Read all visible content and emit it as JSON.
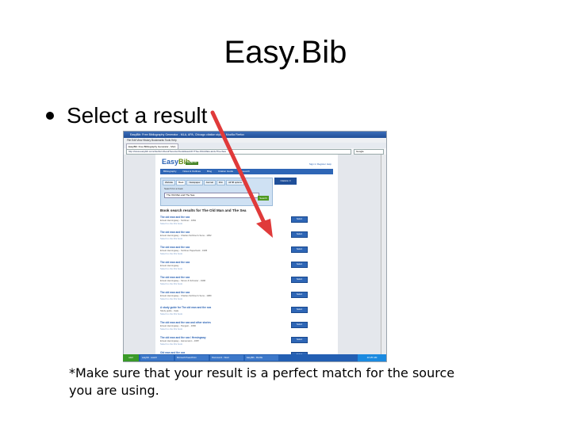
{
  "slide": {
    "title": "Easy.Bib",
    "bullet": "Select a result",
    "note": "*Make sure that your result is a perfect match for the source you are using."
  },
  "browser": {
    "window_title": "EasyBib: Free Bibliography Generator - MLA, APA, Chicago citation styles - Mozilla Firefox",
    "menu": "File  Edit  View  History  Bookmarks  Tools  Help",
    "tab_label": "EasyBib: Free Bibliography Generator - MLA",
    "url": "http://www.easybib.com/cite/form/book?source=book&search=The+Old+Man+and+The+Sea",
    "search_placeholder": "Google"
  },
  "easybib": {
    "logo_main": "Easy",
    "logo_accent": "Bib",
    "promo": "EasyBib Pro",
    "user_links": "Sign in  Register  Help",
    "nav": [
      "Bibliography",
      "Notes & Outlines",
      "Blog",
      "Citation Guide",
      "Research"
    ],
    "source_tabs": [
      "Website",
      "Book",
      "Newspaper",
      "Journal",
      "Film",
      "All 58 options"
    ],
    "search_label": "Search for a book",
    "search_value": "The Old Man and The Sea",
    "search_button": "Search",
    "cite_count": "Citations: 0",
    "results_heading": "Book search results for The Old Man and The Sea",
    "results": [
      {
        "title": "The old man and the sea",
        "meta": "Ernest Hemingway - Scribner - 1952",
        "url": "Select to cite this book"
      },
      {
        "title": "The old man and the sea",
        "meta": "Ernest Hemingway - Charles Scribner's Sons - 1952",
        "url": "Select to cite this book"
      },
      {
        "title": "The old man and the sea",
        "meta": "Ernest Hemingway - Scribner Paperback - 1995",
        "url": "Select to cite this book"
      },
      {
        "title": "The old man and the sea",
        "meta": "Ernest Hemingway",
        "url": "Select to cite this book"
      },
      {
        "title": "The old man and the sea",
        "meta": "Ernest Hemingway - Simon & Schuster - 1996",
        "url": "Select to cite this book"
      },
      {
        "title": "The old man and the sea",
        "meta": "Ernest Hemingway - Charles Scribner's Sons - 1980",
        "url": "Select to cite this book"
      },
      {
        "title": "A study guide for The old man and the sea",
        "meta": "Study guide - Gale",
        "url": "Select to cite this book"
      },
      {
        "title": "The old man and the sea and other stories",
        "meta": "Ernest Hemingway - Penguin - 1966",
        "url": "Select to cite this book"
      },
      {
        "title": "The old man and the sea / Hemingway",
        "meta": "Ernest Hemingway - Heinemann - 1987",
        "url": "Select to cite this book"
      },
      {
        "title": "Old man and the sea",
        "meta": "Ernest Hemingway",
        "url": "Select to cite this book"
      }
    ],
    "select_label": "Select"
  },
  "taskbar": {
    "start": "start",
    "tasks": [
      "easybib - search",
      "Microsoft PowerPoint",
      "Document1 - Word",
      "EasyBib - Mozilla"
    ],
    "clock": "10:25 AM"
  },
  "colors": {
    "annotation_arrow": "#e03a3a",
    "easybib_blue": "#2e66b6",
    "easybib_green": "#4f9a22"
  }
}
